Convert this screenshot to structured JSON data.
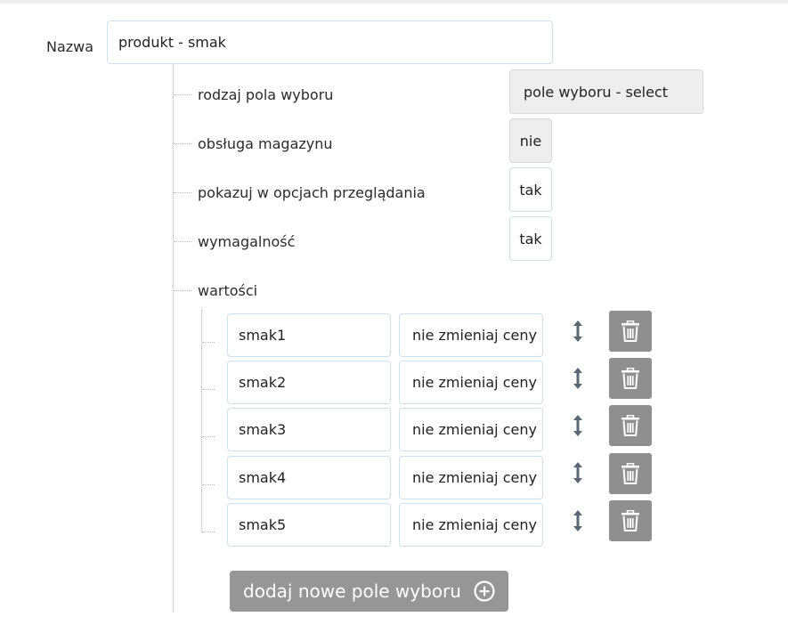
{
  "form": {
    "name_label": "Nazwa",
    "name_value": "produkt - smak"
  },
  "options": [
    {
      "label": "rodzaj pola wyboru",
      "value": "pole wyboru - select"
    },
    {
      "label": "obsługa magazynu",
      "value": "nie"
    },
    {
      "label": "pokazuj w opcjach przeglądania",
      "value": "tak"
    },
    {
      "label": "wymagalność",
      "value": "tak"
    }
  ],
  "values_section": {
    "label": "wartości",
    "rows": [
      {
        "name": "smak1",
        "price": "nie zmieniaj ceny"
      },
      {
        "name": "smak2",
        "price": "nie zmieniaj ceny"
      },
      {
        "name": "smak3",
        "price": "nie zmieniaj ceny"
      },
      {
        "name": "smak4",
        "price": "nie zmieniaj ceny"
      },
      {
        "name": "smak5",
        "price": "nie zmieniaj ceny"
      }
    ]
  },
  "add_button": {
    "label": "dodaj nowe pole wyboru",
    "icon": "plus-circle-icon"
  },
  "icons": {
    "sort": "sort-vertical-icon",
    "delete": "trash-icon"
  },
  "colors": {
    "input_border": "#cfe0ee",
    "readonly_bg": "#eeeeee",
    "button_bg": "#8f8f8f",
    "handle_color": "#5a6775"
  }
}
